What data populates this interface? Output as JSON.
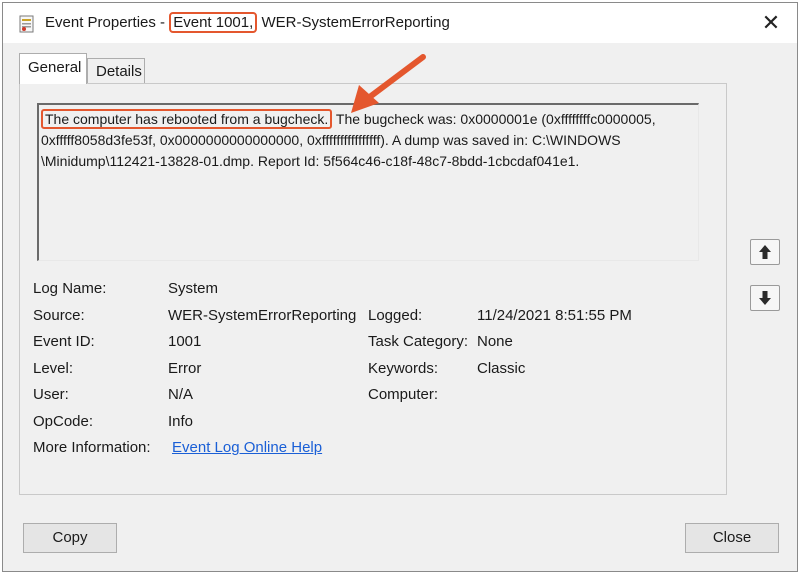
{
  "window": {
    "title_prefix": "Event Properties - ",
    "title_event": "Event 1001,",
    "title_suffix": " WER-SystemErrorReporting",
    "close_glyph": "✕"
  },
  "tabs": [
    {
      "label": "General",
      "selected": true
    },
    {
      "label": "Details",
      "selected": false
    }
  ],
  "description": {
    "highlighted": "The computer has rebooted from a bugcheck.",
    "line1_rest": " The bugcheck was: 0x0000001e (0xffffffffc0000005,",
    "line2": "0xfffff8058d3fe53f, 0x0000000000000000, 0xffffffffffffffff). A dump was saved in: C:\\WINDOWS",
    "line3": "\\Minidump\\112421-13828-01.dmp. Report Id: 5f564c46-c18f-48c7-8bdd-1cbcdaf041e1."
  },
  "fields": {
    "log_name": {
      "label": "Log Name:",
      "value": "System"
    },
    "source": {
      "label": "Source:",
      "value": "WER-SystemErrorReporting"
    },
    "event_id": {
      "label": "Event ID:",
      "value": "1001"
    },
    "level": {
      "label": "Level:",
      "value": "Error"
    },
    "user": {
      "label": "User:",
      "value": "N/A"
    },
    "opcode": {
      "label": "OpCode:",
      "value": "Info"
    },
    "more_info": {
      "label": "More Information:",
      "value": "Event Log Online Help"
    },
    "logged": {
      "label": "Logged:",
      "value": "11/24/2021 8:51:55 PM"
    },
    "task_category": {
      "label": "Task Category:",
      "value": "None"
    },
    "keywords": {
      "label": "Keywords:",
      "value": "Classic"
    },
    "computer": {
      "label": "Computer:",
      "value": ""
    }
  },
  "buttons": {
    "copy": "Copy",
    "close": "Close"
  },
  "icons": {
    "scroll_up": "up-arrow-icon",
    "scroll_down": "down-arrow-icon",
    "annotation_color": "#e4572e"
  }
}
